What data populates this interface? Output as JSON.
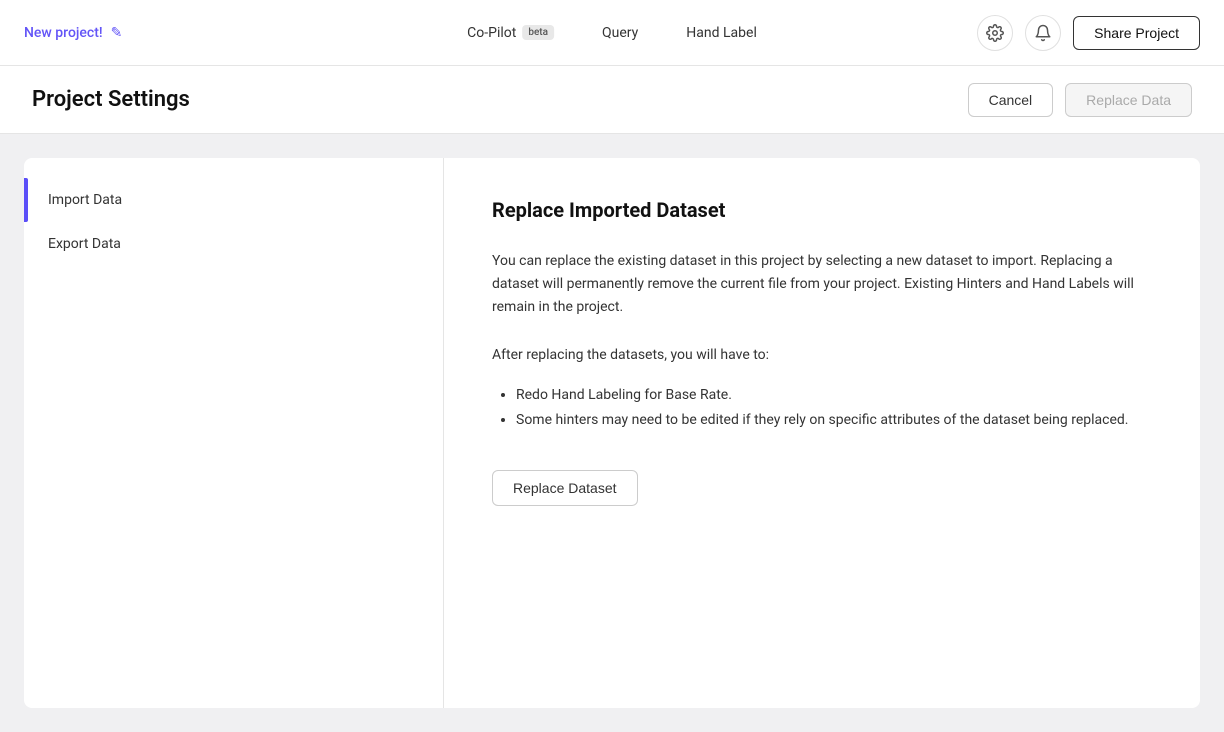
{
  "nav": {
    "new_project_label": "New project!",
    "copilot_label": "Co-Pilot",
    "beta_badge": "beta",
    "query_label": "Query",
    "hand_label_label": "Hand Label",
    "settings_icon": "⚙",
    "bell_icon": "🔔",
    "share_project_label": "Share Project"
  },
  "page_header": {
    "title": "Project Settings",
    "cancel_label": "Cancel",
    "replace_data_label": "Replace Data"
  },
  "sidebar": {
    "items": [
      {
        "label": "Import Data",
        "active": true
      },
      {
        "label": "Export Data",
        "active": false
      }
    ]
  },
  "content": {
    "title": "Replace Imported Dataset",
    "body": "You can replace the existing dataset in this project by selecting a new dataset to import. Replacing a dataset will permanently remove the current file from your project. Existing Hinters and Hand Labels will remain in the project.",
    "after_text": "After replacing the datasets, you will have to:",
    "bullets": [
      "Redo Hand Labeling for Base Rate.",
      "Some hinters may need to be edited if they rely on specific attributes of the dataset being replaced."
    ],
    "replace_dataset_btn_label": "Replace Dataset"
  }
}
